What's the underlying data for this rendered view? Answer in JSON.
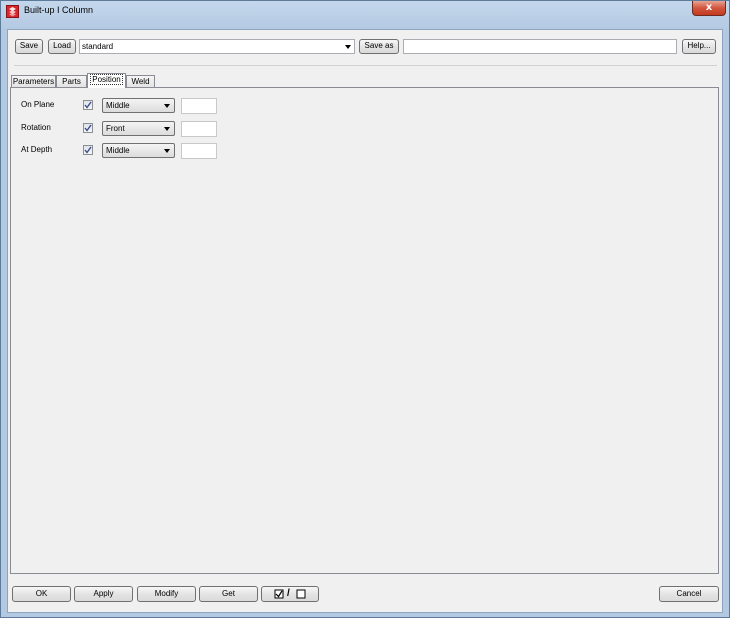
{
  "window": {
    "title": "Built-up I Column",
    "close_glyph": "x"
  },
  "toolbar": {
    "save_label": "Save",
    "load_label": "Load",
    "attribute_file_value": "standard",
    "save_as_label": "Save as",
    "save_as_value": "",
    "help_label": "Help..."
  },
  "tabs": [
    {
      "label": "Parameters"
    },
    {
      "label": "Parts"
    },
    {
      "label": "Position",
      "active": true
    },
    {
      "label": "Weld"
    }
  ],
  "position": {
    "rows": [
      {
        "label": "On Plane",
        "checked": true,
        "value": "Middle",
        "offset": ""
      },
      {
        "label": "Rotation",
        "checked": true,
        "value": "Front",
        "offset": ""
      },
      {
        "label": "At Depth",
        "checked": true,
        "value": "Middle",
        "offset": ""
      }
    ]
  },
  "footer": {
    "ok_label": "OK",
    "apply_label": "Apply",
    "modify_label": "Modify",
    "get_label": "Get",
    "toggle_separator": "/",
    "cancel_label": "Cancel"
  },
  "icons": {
    "app": "tekla-component-icon",
    "checkbox": "check-icon",
    "dropdown": "chevron-down-icon"
  }
}
